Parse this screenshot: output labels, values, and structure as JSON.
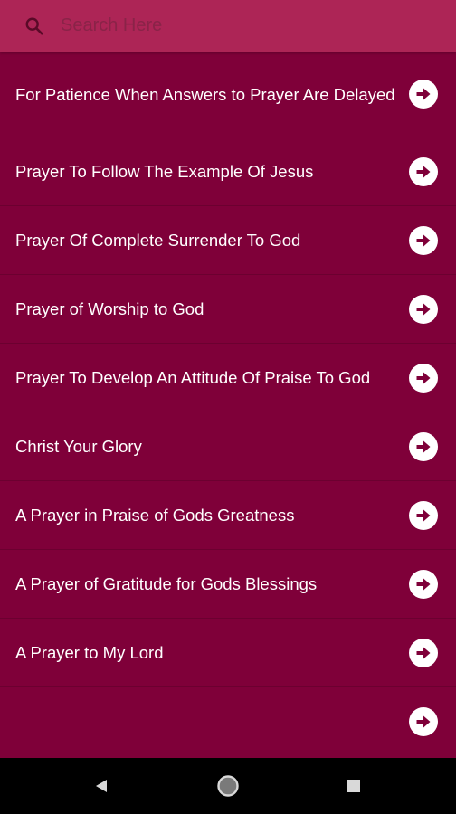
{
  "search": {
    "placeholder": "Search Here",
    "value": ""
  },
  "prayers": [
    {
      "label": "For Patience When Answers to Prayer Are Delayed"
    },
    {
      "label": "Prayer To Follow The Example Of Jesus"
    },
    {
      "label": "Prayer Of Complete Surrender To God"
    },
    {
      "label": "Prayer of Worship to God"
    },
    {
      "label": "Prayer To Develop An Attitude Of Praise To God"
    },
    {
      "label": "Christ Your Glory"
    },
    {
      "label": "A Prayer in Praise of Gods Greatness"
    },
    {
      "label": "A Prayer of Gratitude for Gods Blessings"
    },
    {
      "label": "A Prayer to My Lord"
    },
    {
      "label": ""
    }
  ],
  "icons": {
    "search": "search-icon",
    "item_action": "arrow-right-circle-icon",
    "nav_back": "back-triangle-icon",
    "nav_home": "home-circle-icon",
    "nav_recents": "recents-square-icon"
  },
  "colors": {
    "background": "#7f0039",
    "search_bar": "#ad2556",
    "item_text": "#ffffff",
    "nav_bar": "#000000"
  }
}
